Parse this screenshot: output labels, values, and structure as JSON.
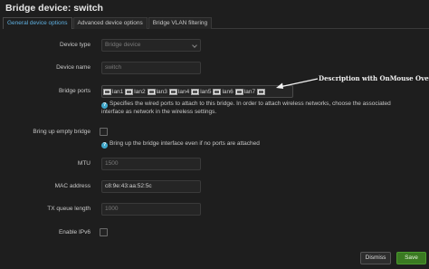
{
  "dialog": {
    "title": "Bridge device: switch"
  },
  "tabs": [
    {
      "label": "General device options",
      "active": true
    },
    {
      "label": "Advanced device options",
      "active": false
    },
    {
      "label": "Bridge VLAN filtering",
      "active": false
    }
  ],
  "fields": {
    "device_type": {
      "label": "Device type",
      "value": "Bridge device"
    },
    "device_name": {
      "label": "Device name",
      "value": "switch"
    },
    "bridge_ports": {
      "label": "Bridge ports",
      "ports": [
        "lan1",
        "lan2",
        "lan3",
        "lan4",
        "lan5",
        "lan6",
        "lan7",
        ""
      ],
      "hint": "Specifies the wired ports to attach to this bridge. In order to attach wireless networks, choose the associated interface as network in the wireless settings."
    },
    "bring_up_empty": {
      "label": "Bring up empty bridge",
      "checked": false,
      "hint": "Bring up the bridge interface even if no ports are attached"
    },
    "mtu": {
      "label": "MTU",
      "placeholder": "1500"
    },
    "mac": {
      "label": "MAC address",
      "value": "c8:9e:43:aa:52:5c"
    },
    "tx_queue": {
      "label": "TX queue length",
      "placeholder": "1000"
    },
    "ipv6": {
      "label": "Enable IPv6",
      "checked": false
    }
  },
  "annotation": "Description with OnMouse Over",
  "footer": {
    "dismiss_label": "Dismiss",
    "save_label": "Save"
  },
  "colors": {
    "accent": "#5fb0e0",
    "save": "#3a7a22",
    "help": "#3fa6c9"
  }
}
